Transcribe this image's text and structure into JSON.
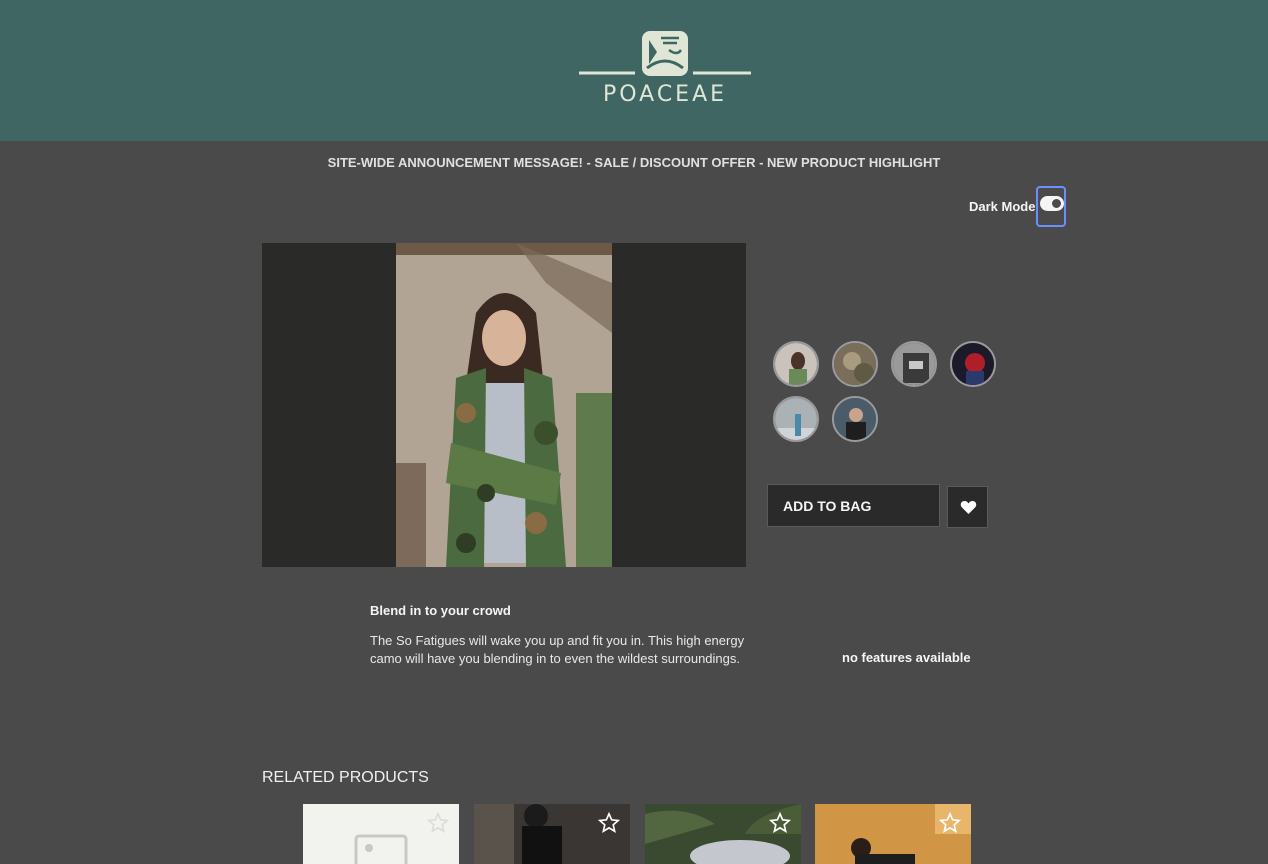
{
  "brand": {
    "name": "POACEAE"
  },
  "announcement": "SITE-WIDE ANNOUNCEMENT MESSAGE! - SALE / DISCOUNT OFFER - NEW PRODUCT HIGHLIGHT",
  "dark_mode": {
    "label": "Dark Mode",
    "enabled": true
  },
  "product": {
    "add_to_bag": "ADD TO BAG",
    "description_title": "Blend in to your crowd",
    "description": "The So Fatigues will wake you up and fit you in. This high energy camo will have you blending in to even the wildest surroundings.",
    "features_text": "no features available"
  },
  "swatches": [
    "swatch-1",
    "swatch-2",
    "swatch-3",
    "swatch-4",
    "swatch-5",
    "swatch-6"
  ],
  "related": {
    "title": "RELATED PRODUCTS"
  },
  "colors": {
    "header": "#3f6663",
    "background": "#4a4a4a",
    "panel": "#2a2a2a",
    "focus": "#6b8fff"
  }
}
